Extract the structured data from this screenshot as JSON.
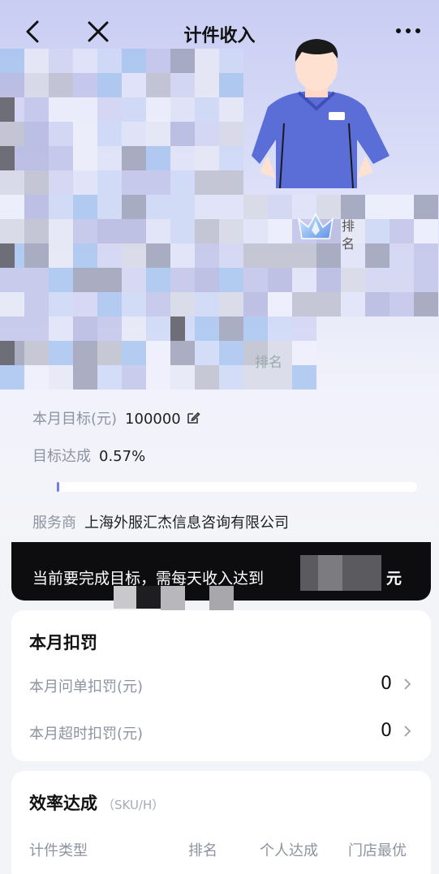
{
  "nav": {
    "title": "计件收入",
    "back_icon": "chevron-left-icon",
    "close_icon": "close-icon",
    "more_icon": "more-dots-icon"
  },
  "profile": {
    "rank_label_top": "排\n名",
    "rank_label_bottom": "排名"
  },
  "target": {
    "label": "本月目标(元)",
    "value": "100000",
    "edit_icon": "edit-icon"
  },
  "achievement": {
    "label": "目标达成",
    "value": "0.57%",
    "progress": 0.0057
  },
  "provider": {
    "label": "服务商",
    "value": "上海外服汇杰信息咨询有限公司"
  },
  "notice": {
    "text": "当前要完成目标，需每天收入达到",
    "unit": "元"
  },
  "penalty_card": {
    "title": "本月扣罚",
    "rows": [
      {
        "label": "本月问单扣罚(元)",
        "value": "0"
      },
      {
        "label": "本月超时扣罚(元)",
        "value": "0"
      }
    ]
  },
  "efficiency_card": {
    "title": "效率达成",
    "subtitle": "（SKU/H）",
    "columns": [
      "计件类型",
      "排名",
      "个人达成",
      "门店最优"
    ]
  },
  "colors": {
    "accent": "#6d7df0",
    "notice_bg": "#0d0d0f",
    "hero_bg": "#c9cdf3"
  }
}
